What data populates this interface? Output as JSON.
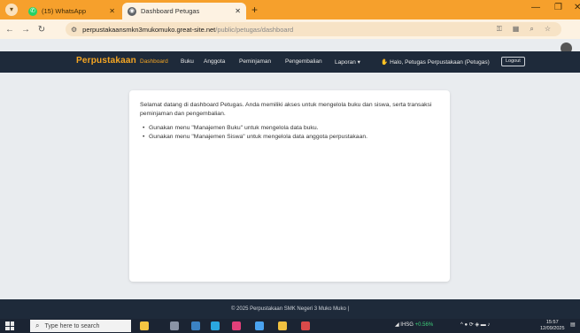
{
  "browser": {
    "tabs": [
      {
        "title": "(15) WhatsApp",
        "icon": "whatsapp-icon"
      },
      {
        "title": "Dashboard Petugas",
        "icon": "globe-icon"
      }
    ],
    "url_host": "perpustakaansmkn3mukomuko.great-site.net",
    "url_path": "/public/petugas/dashboard",
    "accent_color": "#f6a02c"
  },
  "navbar": {
    "brand": "Perpustakaan",
    "links": [
      "Dashboard",
      "Buku",
      "Anggota",
      "Peminjaman",
      "Pengembalian",
      "Laporan ▾"
    ],
    "greeting": "Halo, Petugas Perpustakaan (Petugas)",
    "logout": "Logout",
    "brand_color": "#f5a623",
    "bg_color": "#1e2a3a"
  },
  "content": {
    "intro": "Selamat datang di dashboard Petugas. Anda memiliki akses untuk mengelola buku dan siswa, serta transaksi peminjaman dan pengembalian.",
    "bullets": [
      "Gunakan menu \"Manajemen Buku\" untuk mengelola data buku.",
      "Gunakan menu \"Manajemen Siswa\" untuk mengelola data anggota perpustakaan."
    ]
  },
  "footer": {
    "text": "© 2025 Perpustakaan SMK Negeri 3 Muko Muko |"
  },
  "taskbar": {
    "search_placeholder": "Type here to search",
    "ticker_name": "IHSG",
    "ticker_change": "+0.56%",
    "time": "15:57",
    "date": "12/09/2025"
  }
}
